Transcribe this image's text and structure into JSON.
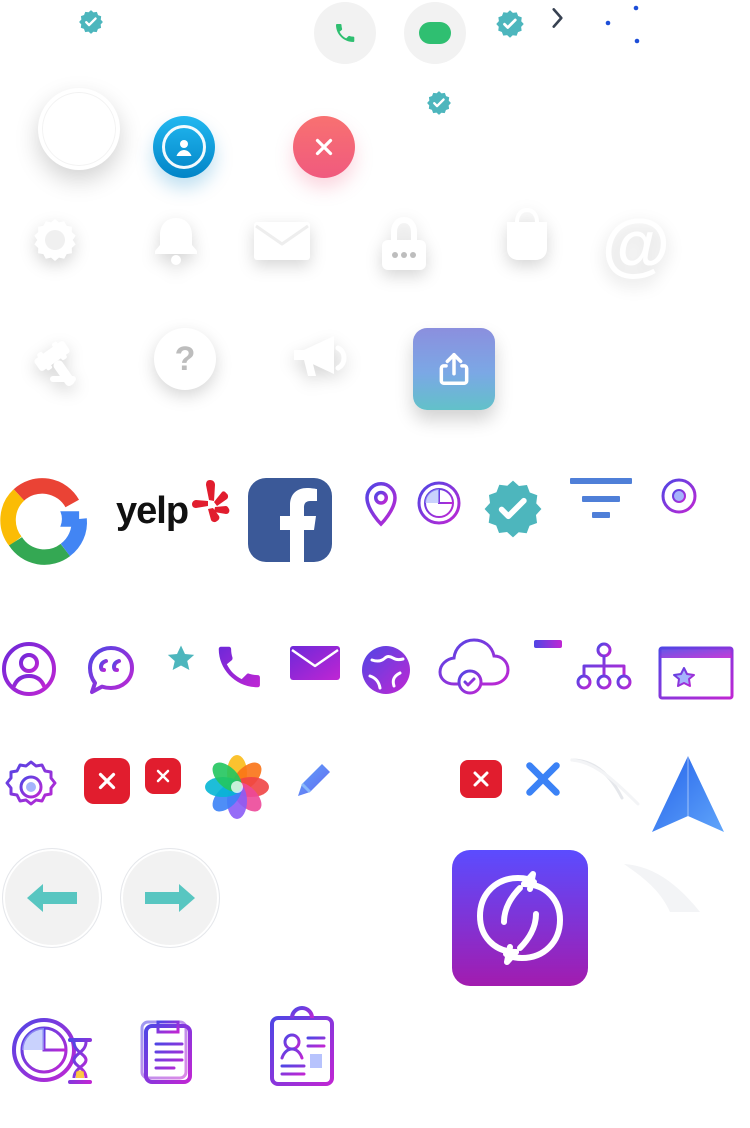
{
  "colors": {
    "teal": "#4DB6BD",
    "green": "#2FBF71",
    "blue": "#0EA5E9",
    "red": "#E11D2E",
    "pink": "#F05A7E",
    "purple": "#7C3AED",
    "violet": "#A855F7",
    "magenta": "#C026D3",
    "gray": "#E9E9E9",
    "light_gray": "#F2F2F2",
    "facebook": "#3B5998"
  },
  "brands": {
    "yelp": "yelp"
  },
  "glyphs": {
    "question": "?",
    "at": "@"
  }
}
